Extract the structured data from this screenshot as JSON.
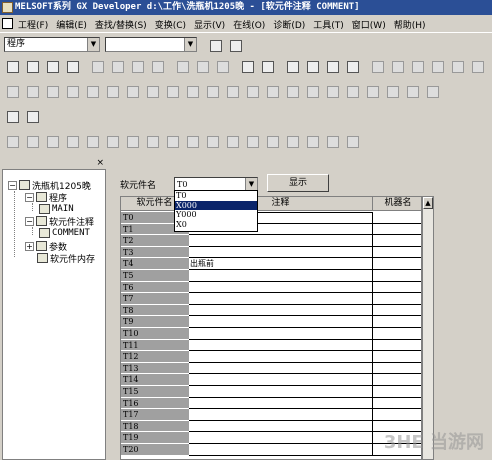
{
  "window": {
    "title": "MELSOFT系列 GX Developer d:\\工作\\洗瓶机1205晚 - [软元件注释 COMMENT]"
  },
  "menu": {
    "items": [
      "工程(F)",
      "编辑(E)",
      "查找/替换(S)",
      "变换(C)",
      "显示(V)",
      "在线(O)",
      "诊断(D)",
      "工具(T)",
      "窗口(W)",
      "帮助(H)"
    ]
  },
  "toolbar": {
    "project_combo": "程序",
    "second_combo": ""
  },
  "tree": {
    "close": "×",
    "root": "洗瓶机1205晚",
    "program": "程序",
    "main": "MAIN",
    "device_comment": "软元件注释",
    "comment": "COMMENT",
    "parameter": "参数",
    "device_memory": "软元件内存"
  },
  "form": {
    "device_name_label": "软元件名",
    "device_name_value": "T0",
    "display_button": "显示",
    "dropdown_options": [
      "T0",
      "X000",
      "Y000",
      "X0"
    ],
    "dropdown_selected": "X000"
  },
  "grid": {
    "headers": {
      "device": "软元件名",
      "comment": "注释",
      "label": "机器名"
    },
    "rows": [
      {
        "device": "T0",
        "comment": ""
      },
      {
        "device": "T1",
        "comment": ""
      },
      {
        "device": "T2",
        "comment": ""
      },
      {
        "device": "T3",
        "comment": ""
      },
      {
        "device": "T4",
        "comment": "出瓶前"
      },
      {
        "device": "T5",
        "comment": ""
      },
      {
        "device": "T6",
        "comment": ""
      },
      {
        "device": "T7",
        "comment": ""
      },
      {
        "device": "T8",
        "comment": ""
      },
      {
        "device": "T9",
        "comment": ""
      },
      {
        "device": "T10",
        "comment": ""
      },
      {
        "device": "T11",
        "comment": ""
      },
      {
        "device": "T12",
        "comment": ""
      },
      {
        "device": "T13",
        "comment": ""
      },
      {
        "device": "T14",
        "comment": ""
      },
      {
        "device": "T15",
        "comment": ""
      },
      {
        "device": "T16",
        "comment": ""
      },
      {
        "device": "T17",
        "comment": ""
      },
      {
        "device": "T18",
        "comment": ""
      },
      {
        "device": "T19",
        "comment": ""
      },
      {
        "device": "T20",
        "comment": ""
      }
    ]
  },
  "watermark": {
    "text": "3HE 当游网"
  }
}
